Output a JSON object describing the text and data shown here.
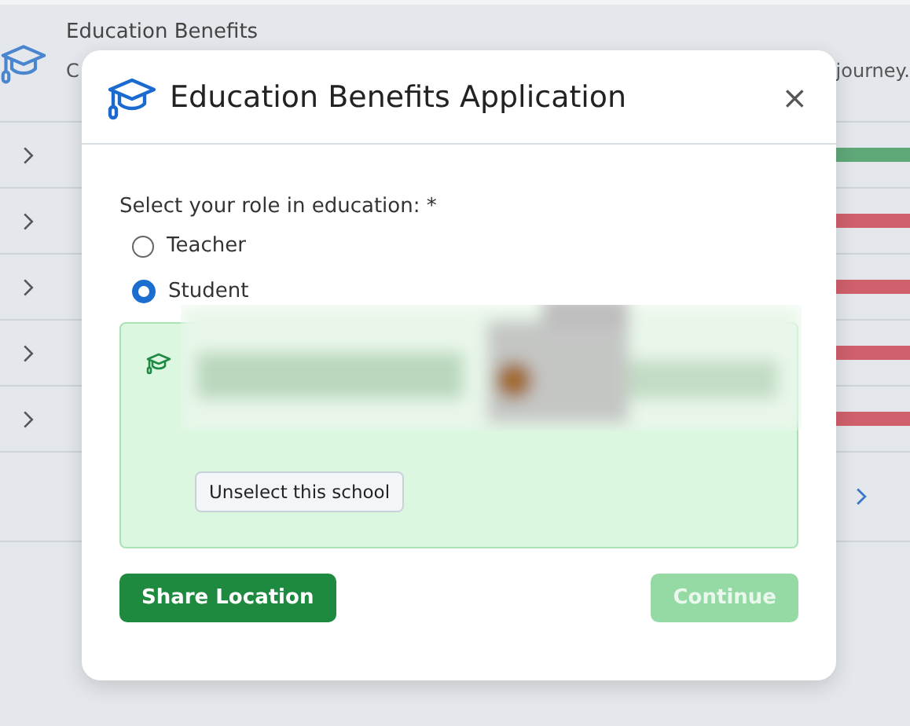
{
  "background": {
    "header": {
      "title": "Education Benefits",
      "subtitle_start": "C",
      "subtitle_end": "journey."
    },
    "rows": [
      {
        "expanded": false,
        "color": "#5fa878"
      },
      {
        "expanded": false,
        "color": "#d0606c"
      },
      {
        "expanded": false,
        "color": "#d0606c"
      },
      {
        "expanded": false,
        "color": "#d0606c"
      },
      {
        "expanded": false,
        "color": "#d0606c"
      }
    ]
  },
  "dialog": {
    "title": "Education Benefits Application",
    "close": "×",
    "role_label": "Select your role in education: *",
    "roles": [
      {
        "label": "Teacher",
        "selected": false
      },
      {
        "label": "Student",
        "selected": true
      }
    ],
    "school_card": {
      "kind": "picture",
      "unselect_button": "Unselect this school"
    },
    "buttons": [
      {
        "label": "Share Location",
        "disabled": false
      },
      {
        "label": "Continue",
        "disabled": true
      }
    ]
  }
}
